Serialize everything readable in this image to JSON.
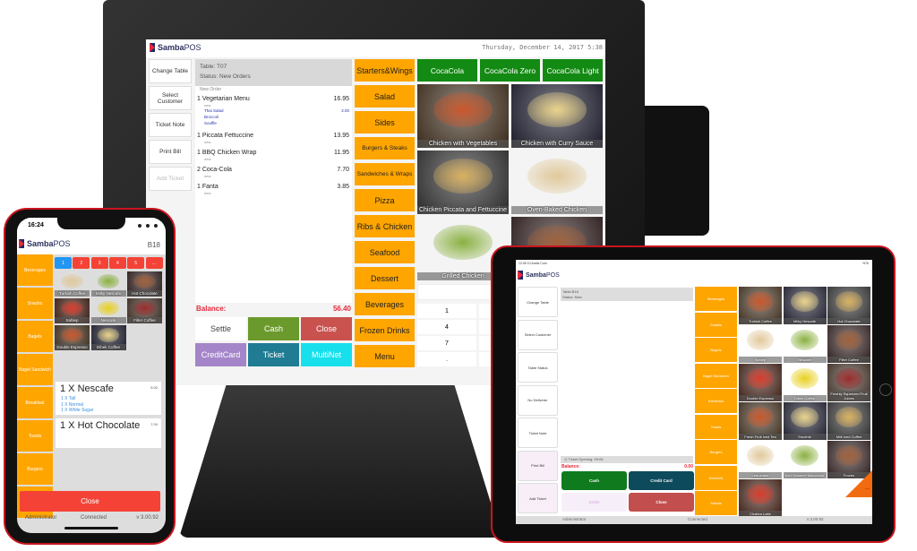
{
  "brand": {
    "name_bold": "Samba",
    "name_light": "POS"
  },
  "monitor": {
    "datetime": "Thursday, December 14, 2017 5:38",
    "left_buttons": [
      "Change Table",
      "Select Customer",
      "Ticket Note",
      "Print Bill",
      "Add Ticket"
    ],
    "ticket": {
      "table": "Table: T07",
      "status": "Status: New Orders",
      "section": "New Order",
      "orders": [
        {
          "qty": "1",
          "name": "Vegetarian Menu",
          "price": "16.95",
          "tag": "new",
          "modifiers": [
            "Thai Salad",
            "Broccoli",
            "Souffle"
          ],
          "modifier_price": "2.00"
        },
        {
          "qty": "1",
          "name": "Piccata Fettuccine",
          "price": "13.95",
          "tag": "new"
        },
        {
          "qty": "1",
          "name": "BBQ Chicken Wrap",
          "price": "11.95",
          "tag": "new"
        },
        {
          "qty": "2",
          "name": "Coca-Cola",
          "price": "7.70",
          "tag": "new"
        },
        {
          "qty": "1",
          "name": "Fanta",
          "price": "3.85",
          "tag": "new"
        }
      ],
      "balance_label": "Balance:",
      "balance": "56.40"
    },
    "actions": [
      {
        "label": "Settle",
        "color": "#ffffff",
        "text": "#444"
      },
      {
        "label": "Cash",
        "color": "#6b9a2c",
        "text": "#fff"
      },
      {
        "label": "Close",
        "color": "#c9524f",
        "text": "#fff"
      },
      {
        "label": "CreditCard",
        "color": "#a585c9",
        "text": "#fff"
      },
      {
        "label": "Ticket",
        "color": "#1f7c93",
        "text": "#fff"
      },
      {
        "label": "MultiNet",
        "color": "#17e0ec",
        "text": "#fff"
      }
    ],
    "categories": [
      "Starters&Wings",
      "Salad",
      "Sides",
      "Burgers & Steaks",
      "Sandwiches & Wraps",
      "Pizza",
      "Ribs & Chicken",
      "Seafood",
      "Dessert",
      "Beverages",
      "Frozen Drinks",
      "Menu"
    ],
    "drinks": [
      "CocaCola",
      "CocaCola Zero",
      "CocaCola Light"
    ],
    "products": [
      "Chicken with Vegetables",
      "Chicken with Curry Sauce",
      "Chicken Piccata and Fettuccine",
      "Oven-Baked Chicken",
      "Grilled Chicken",
      ""
    ],
    "numpad": [
      "1",
      "4",
      "7",
      "."
    ]
  },
  "phone": {
    "time": "16:24",
    "table": "B18",
    "categories": [
      "Beverages",
      "Snacks",
      "Bagels",
      "Bagel Sandwich",
      "Breakfast",
      "Toasts",
      "Burgers",
      ""
    ],
    "pages": [
      "1",
      "2",
      "3",
      "4",
      "5",
      "..."
    ],
    "products": [
      "Turkish Coffee",
      "Milky Nescafe",
      "Hot Chocolate",
      "Sahlep",
      "Nescafe",
      "Filter Coffee",
      "Double Espresso",
      "Dibek Coffee"
    ],
    "orders": [
      {
        "name": "1 X Nescafe",
        "price": "5.00",
        "modifiers": [
          "1 X Tall",
          "1 X Normal",
          "1 X White Sugar"
        ]
      },
      {
        "name": "1 X Hot Chocolate",
        "price": "7.00",
        "modifiers": []
      }
    ],
    "close_label": "Close",
    "footer": {
      "user": "Administrator",
      "status": "Connected",
      "version": "v 3.00.92"
    }
  },
  "tablet": {
    "status_time": "12:05  10 Aralık Cum",
    "battery": "%76",
    "left_buttons": [
      "Change Table",
      "Select Customer",
      "Table Status",
      "No Deliverer",
      "Ticket Note",
      "Print Bill",
      "Add Ticket"
    ],
    "ticket": {
      "table": "Table:B18",
      "status": "Status: New",
      "opening": "Ticket Opening: 09:05",
      "balance_label": "Balance:",
      "balance": "0.00"
    },
    "actions": [
      {
        "label": "Cash",
        "color": "#0f7a1e",
        "text": "#fff"
      },
      {
        "label": "Credit Card",
        "color": "#0d4a5c",
        "text": "#fff"
      },
      {
        "label": "Settle",
        "color": "#f6eef8",
        "text": "#e2b8e8"
      },
      {
        "label": "Close",
        "color": "#c24e4e",
        "text": "#fff"
      }
    ],
    "categories": [
      "Beverages",
      "Snacks",
      "Bagels",
      "Bagel Sandwich",
      "Breakfast",
      "Toasts",
      "Burgers",
      "Desserts",
      "Salads"
    ],
    "products": [
      "Turkish Coffee",
      "Milky Nescafe",
      "Hot Chocolate",
      "Sahlep",
      "Nescafe",
      "Filter Coffee",
      "Double Espresso",
      "Dibek Coffee",
      "Freshly Squeezed Fruit Juices",
      "Fresh Fruit Iced Tea",
      "Smothie",
      "Milk Iced Coffee",
      "Lemonade",
      "Iced Karamel Macchiato",
      "Frozen",
      "Chaitea Latte"
    ],
    "more": "...",
    "footer": {
      "user": "Administrator",
      "status": "Connected",
      "version": "v 3.00.92"
    }
  },
  "colors": {
    "accent_orange": "#ffa500",
    "device_red": "#d0161f",
    "balance_red": "#e8293a"
  }
}
